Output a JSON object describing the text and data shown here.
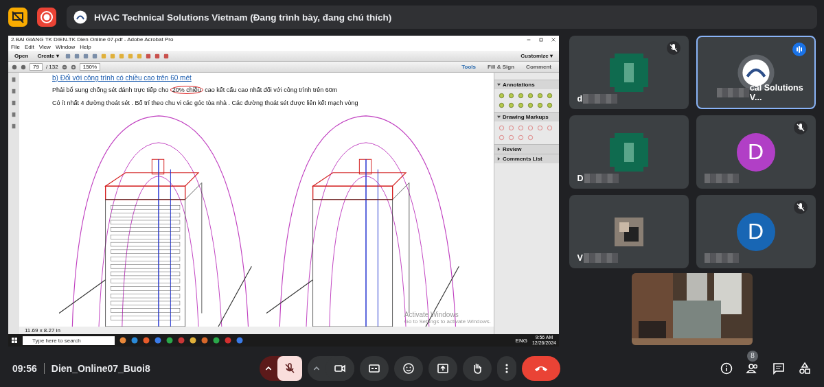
{
  "top_bar": {
    "recording": true,
    "title": "HVAC Technical Solutions Vietnam (Đang trình bày, đang chú thích)"
  },
  "shared_screen": {
    "app": {
      "title": "2.BAI GIANG TK DIEN-TK Dien Online 07.pdf - Adobe Acrobat Pro",
      "menu": [
        "File",
        "Edit",
        "View",
        "Window",
        "Help"
      ],
      "open_button": "Open",
      "create_button": "Create ▾",
      "customize": "Customize ▾",
      "page": "79",
      "pages": "/ 132",
      "zoom": "150%",
      "panel_tabs": [
        {
          "label": "Tools",
          "selected": true
        },
        {
          "label": "Fill & Sign",
          "selected": false
        },
        {
          "label": "Comment",
          "selected": false
        }
      ],
      "document": {
        "heading": "b) Đối với công trình có chiều cao trên 60 mét",
        "paragraphs": [
          [
            {
              "text": "Phải bổ sung chống sét đánh trực tiếp cho ",
              "circled": false
            },
            {
              "text": "20% chiều",
              "circled": true
            },
            {
              "text": " cao kết cấu cao nhất đối với công trình trên 60m",
              "circled": false
            }
          ],
          [
            {
              "text": "Có ít nhất 4 đường thoát sét . Bố trí theo chu vi  các góc tòa nhà . Các đường thoát sét được liên kết mạch vòng",
              "circled": false
            }
          ]
        ]
      },
      "side_sections": [
        {
          "label": "Annotations",
          "expanded": true
        },
        {
          "label": "Drawing Markups",
          "expanded": true
        },
        {
          "label": "Review",
          "expanded": false
        },
        {
          "label": "Comments List",
          "expanded": false
        }
      ],
      "page_size": "11.69 x 8.27 in"
    },
    "activation": {
      "title": "Activate Windows",
      "subtitle": "Go to Settings to activate Windows."
    },
    "taskbar": {
      "search_placeholder": "Type here to search",
      "language": "ENG",
      "time": "9:56 AM",
      "date": "12/26/2024"
    }
  },
  "tiles": [
    {
      "kind": "pixelated",
      "color": "#0f6b4f",
      "name": "d",
      "muted": true,
      "speaking": false
    },
    {
      "kind": "logo",
      "name": "cal Solutions V...",
      "muted": false,
      "speaking": true
    },
    {
      "kind": "pixelated",
      "color": "#0f6b4f",
      "name": "D",
      "muted": false,
      "speaking": false
    },
    {
      "kind": "letter",
      "color": "#b13fc6",
      "initial": "D",
      "muted": true,
      "speaking": false
    },
    {
      "name": "V",
      "muted": false,
      "speaking": false
    },
    {
      "kind": "letter",
      "color": "#1866b4",
      "initial": "D",
      "muted": true,
      "speaking": false
    }
  ],
  "bottom_bar": {
    "time": "09:56",
    "meeting": "Dien_Online07_Buoi8",
    "mic_muted": true,
    "participants_badge": "8"
  }
}
